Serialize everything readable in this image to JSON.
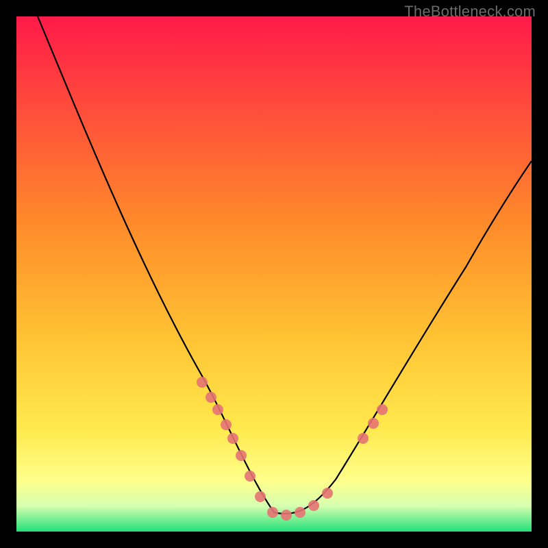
{
  "watermark": {
    "text": "TheBottleneck.com"
  },
  "chart_data": {
    "type": "line",
    "title": "",
    "xlabel": "",
    "ylabel": "",
    "xlim": [
      0,
      100
    ],
    "ylim": [
      0,
      100
    ],
    "grid": false,
    "legend": false,
    "background_gradient": {
      "top_color": "#ff1a49",
      "mid_color": "#ffc233",
      "lower_color": "#ffff8a",
      "bottom_color": "#22e07a"
    },
    "series": [
      {
        "name": "bottleneck-curve",
        "x": [
          0,
          5,
          10,
          15,
          20,
          25,
          30,
          35,
          38,
          42,
          46,
          50,
          54,
          58,
          62,
          68,
          75,
          82,
          90,
          100
        ],
        "y": [
          100,
          88,
          76,
          65,
          55,
          45,
          36,
          28,
          22,
          14,
          7,
          3,
          3,
          5,
          10,
          18,
          28,
          38,
          48,
          58
        ]
      }
    ],
    "markers": {
      "name": "highlighted-points",
      "color": "#e57373",
      "x": [
        33,
        35,
        36,
        38,
        40,
        42,
        44,
        47,
        50,
        53,
        56,
        58,
        64,
        66,
        68
      ],
      "y": [
        30,
        27,
        25,
        22,
        18,
        14,
        10,
        5,
        3,
        3,
        4,
        6,
        13,
        16,
        19
      ]
    }
  }
}
